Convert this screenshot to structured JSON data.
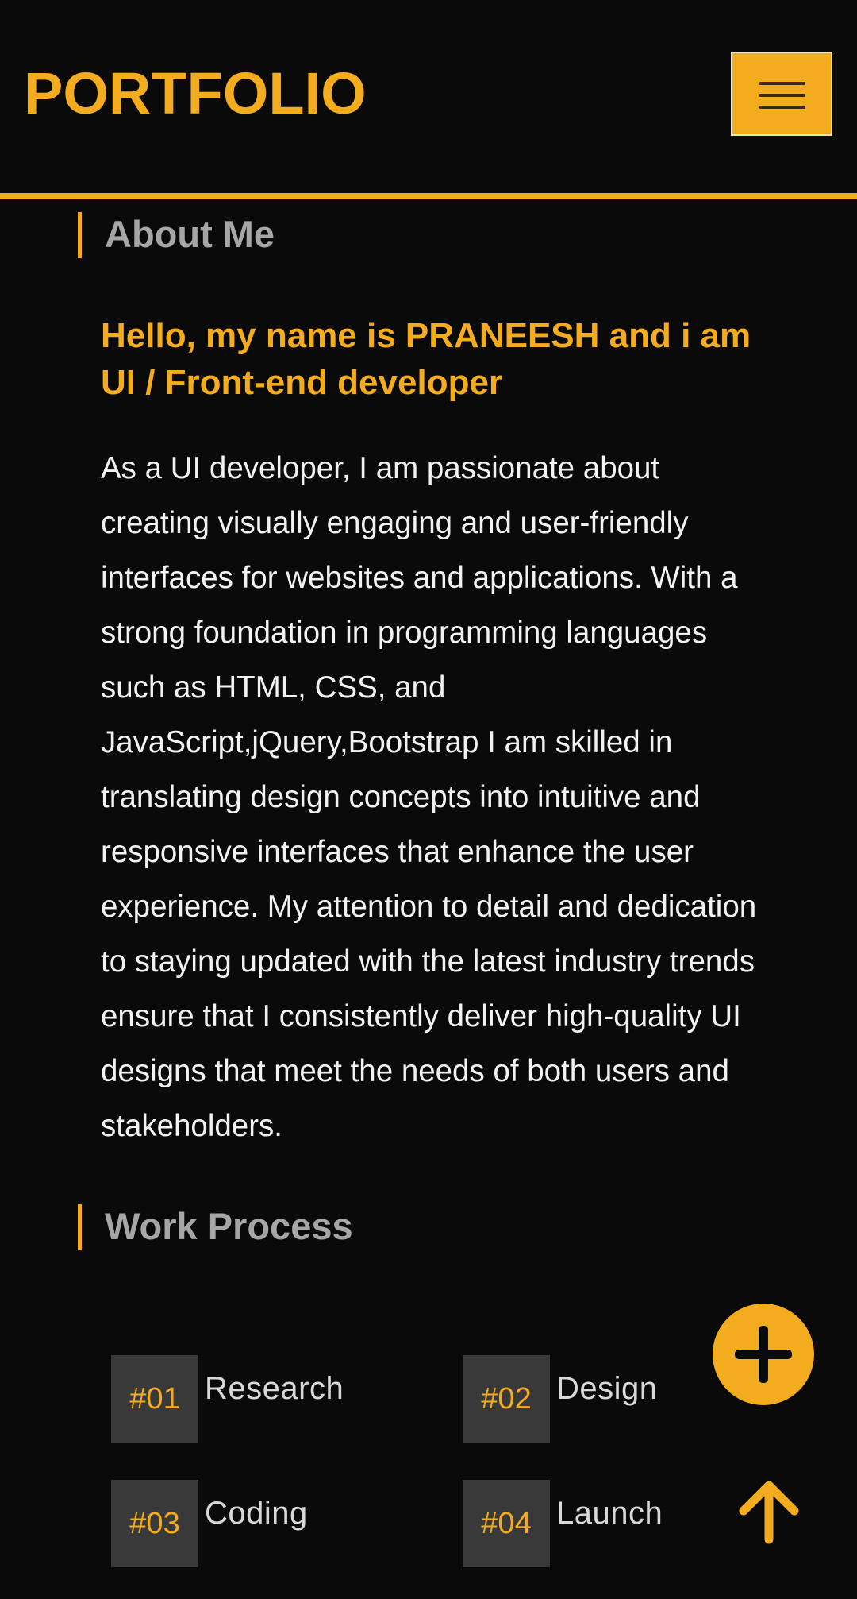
{
  "header": {
    "brand": "PORTFOLIO",
    "menu_icon": "hamburger-menu-icon"
  },
  "about": {
    "section_title": "About Me",
    "headline": "Hello, my name is PRANEESH and i am UI / Front-end developer",
    "body": "As a UI developer, I am passionate about creating visually engaging and user-friendly interfaces for websites and applications. With a strong foundation in programming languages such as HTML, CSS, and JavaScript,jQuery,Bootstrap I am skilled in translating design concepts into intuitive and responsive interfaces that enhance the user experience. My attention to detail and dedication to staying updated with the latest industry trends ensure that I consistently deliver high-quality UI designs that meet the needs of both users and stakeholders."
  },
  "work_process": {
    "section_title": "Work Process",
    "steps": [
      {
        "number": "#01",
        "label": "Research"
      },
      {
        "number": "#02",
        "label": "Design"
      },
      {
        "number": "#03",
        "label": "Coding"
      },
      {
        "number": "#04",
        "label": "Launch"
      }
    ]
  },
  "floating": {
    "plus_icon": "plus-icon",
    "scroll_top_icon": "arrow-up-icon"
  },
  "colors": {
    "accent": "#f4ac1f",
    "background": "#0b0a0a",
    "tile": "#3a3939",
    "section_title": "#a6a6a6"
  }
}
